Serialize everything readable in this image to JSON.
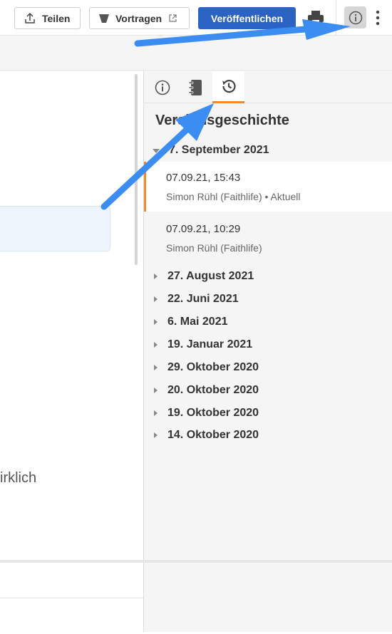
{
  "toolbar": {
    "share_label": "Teilen",
    "present_label": "Vortragen",
    "publish_label": "Veröffentlichen",
    "icons": [
      "share-icon",
      "present-icon",
      "external-link-icon",
      "print-icon",
      "info-icon",
      "more-vertical-icon"
    ]
  },
  "editor": {
    "visible_text": "irklich"
  },
  "panel": {
    "tabs": [
      {
        "name": "info",
        "icon": "info-icon"
      },
      {
        "name": "notebook",
        "icon": "notebook-icon"
      },
      {
        "name": "history",
        "icon": "history-icon",
        "active": true
      }
    ],
    "title": "Versionsgeschichte",
    "groups": [
      {
        "label": "7. September 2021",
        "expanded": true,
        "versions": [
          {
            "time": "07.09.21, 15:43",
            "author": "Simon Rühl (Faithlife) • Aktuell",
            "current": true
          },
          {
            "time": "07.09.21, 10:29",
            "author": "Simon Rühl (Faithlife)",
            "current": false
          }
        ]
      },
      {
        "label": "27. August 2021",
        "expanded": false
      },
      {
        "label": "22. Juni 2021",
        "expanded": false
      },
      {
        "label": "6. Mai 2021",
        "expanded": false
      },
      {
        "label": "19. Januar 2021",
        "expanded": false
      },
      {
        "label": "29. Oktober 2020",
        "expanded": false
      },
      {
        "label": "20. Oktober 2020",
        "expanded": false
      },
      {
        "label": "19. Oktober 2020",
        "expanded": false
      },
      {
        "label": "14. Oktober 2020",
        "expanded": false
      }
    ]
  },
  "colors": {
    "accent_blue": "#2a63c4",
    "active_orange": "#f08a2c",
    "annotation_arrow": "#3b8df2"
  }
}
